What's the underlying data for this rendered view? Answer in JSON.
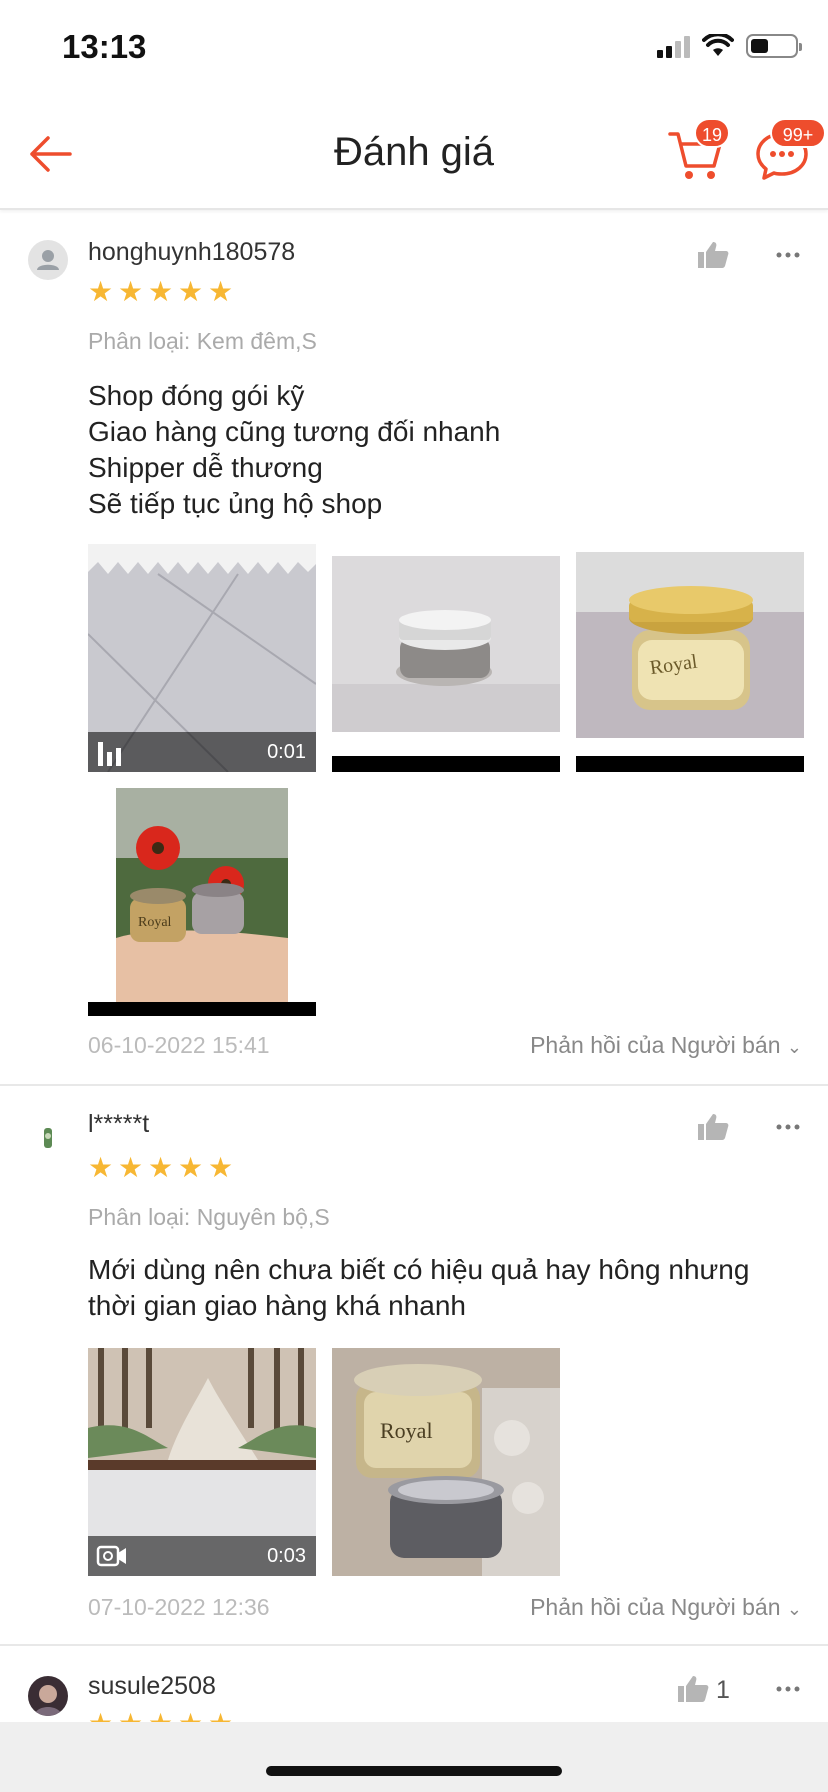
{
  "status_bar": {
    "time": "13:13"
  },
  "header": {
    "title": "Đánh giá",
    "cart_count": "19",
    "chat_count": "99+"
  },
  "colors": {
    "accent": "#ee4d2d",
    "star": "#f7b733"
  },
  "reviews": [
    {
      "username": "honghuynh180578",
      "rating": 5,
      "variant": "Phân loại: Kem đêm,S",
      "comment": "Shop đóng gói kỹ\nGiao hàng cũng tương đối nhanh\nShipper dễ thương\nSẽ tiếp tục ủng hộ shop",
      "video_duration": "0:01",
      "date": "06-10-2022 15:41",
      "reply_label": "Phản hồi của Người bán"
    },
    {
      "username": "l*****t",
      "rating": 5,
      "variant": "Phân loại: Nguyên bộ,S",
      "comment": "Mới dùng nên chưa biết có hiệu quả hay hông nhưng\nthời gian giao hàng khá nhanh",
      "video_duration": "0:03",
      "date": "07-10-2022 12:36",
      "reply_label": "Phản hồi của Người bán"
    },
    {
      "username": "susule2508",
      "rating": 5,
      "like_count": "1"
    }
  ],
  "product_label": "Royal"
}
